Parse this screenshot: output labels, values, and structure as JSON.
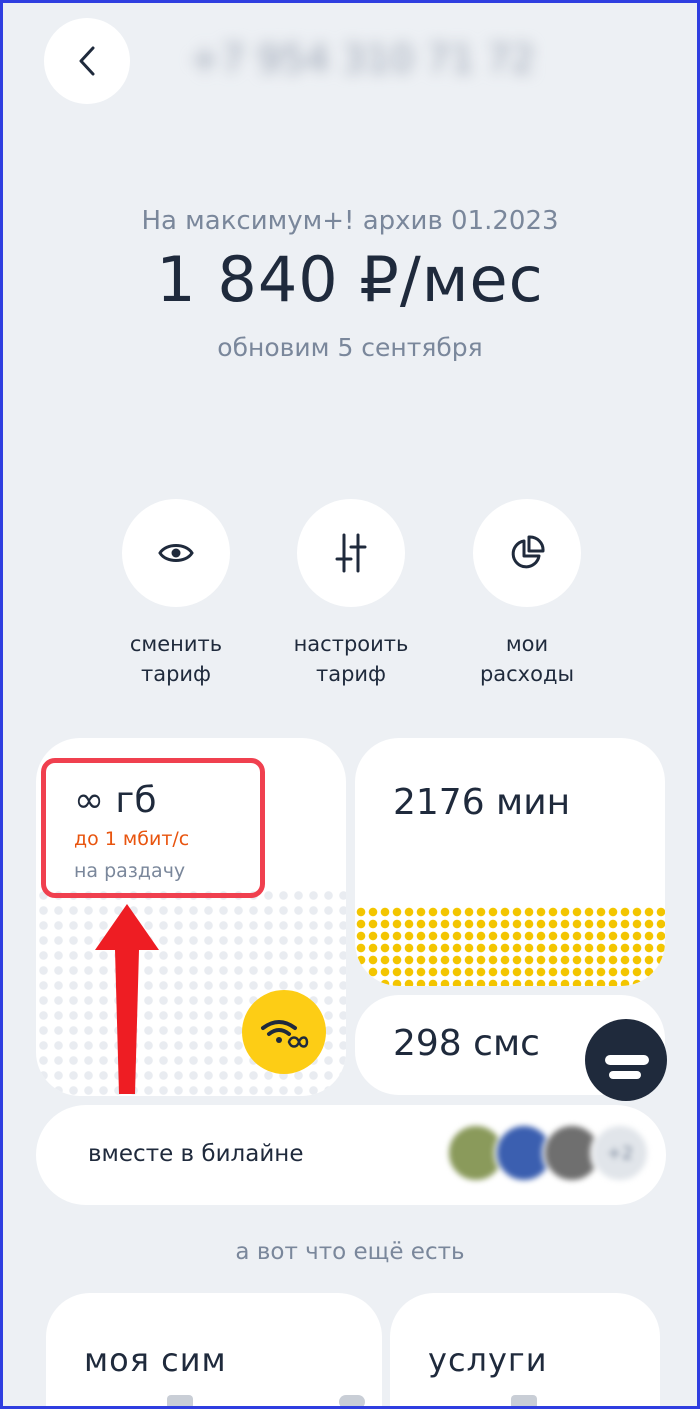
{
  "header": {
    "phone_number": "+7 954 310 71 72"
  },
  "tariff": {
    "name": "На максимум+! архив 01.2023",
    "price": "1 840 ₽/мес",
    "renew_text": "обновим 5 сентября"
  },
  "actions": [
    {
      "label_line1": "сменить",
      "label_line2": "тариф",
      "icon": "eye-icon"
    },
    {
      "label_line1": "настроить",
      "label_line2": "тариф",
      "icon": "sliders-icon"
    },
    {
      "label_line1": "мои",
      "label_line2": "расходы",
      "icon": "pie-chart-icon"
    }
  ],
  "balances": {
    "internet": {
      "value": "∞ гб",
      "speed": "до 1 мбит/с",
      "share": "на раздачу",
      "icon": "wifi-infinity-icon"
    },
    "minutes": {
      "value": "2176 мин"
    },
    "sms": {
      "value": "298 смс"
    }
  },
  "together": {
    "label": "вместе в билайне",
    "extra_count": "+2"
  },
  "more": {
    "title": "а вот что ещё есть",
    "cards": [
      {
        "title": "моя сим"
      },
      {
        "title": "услуги"
      }
    ]
  },
  "colors": {
    "accent_yellow": "#fdcd15",
    "speed_orange": "#e8540e",
    "annotation_red": "#f0404f",
    "text_dark": "#1f2a3c",
    "text_muted": "#7a879b",
    "background": "#edf0f4"
  }
}
